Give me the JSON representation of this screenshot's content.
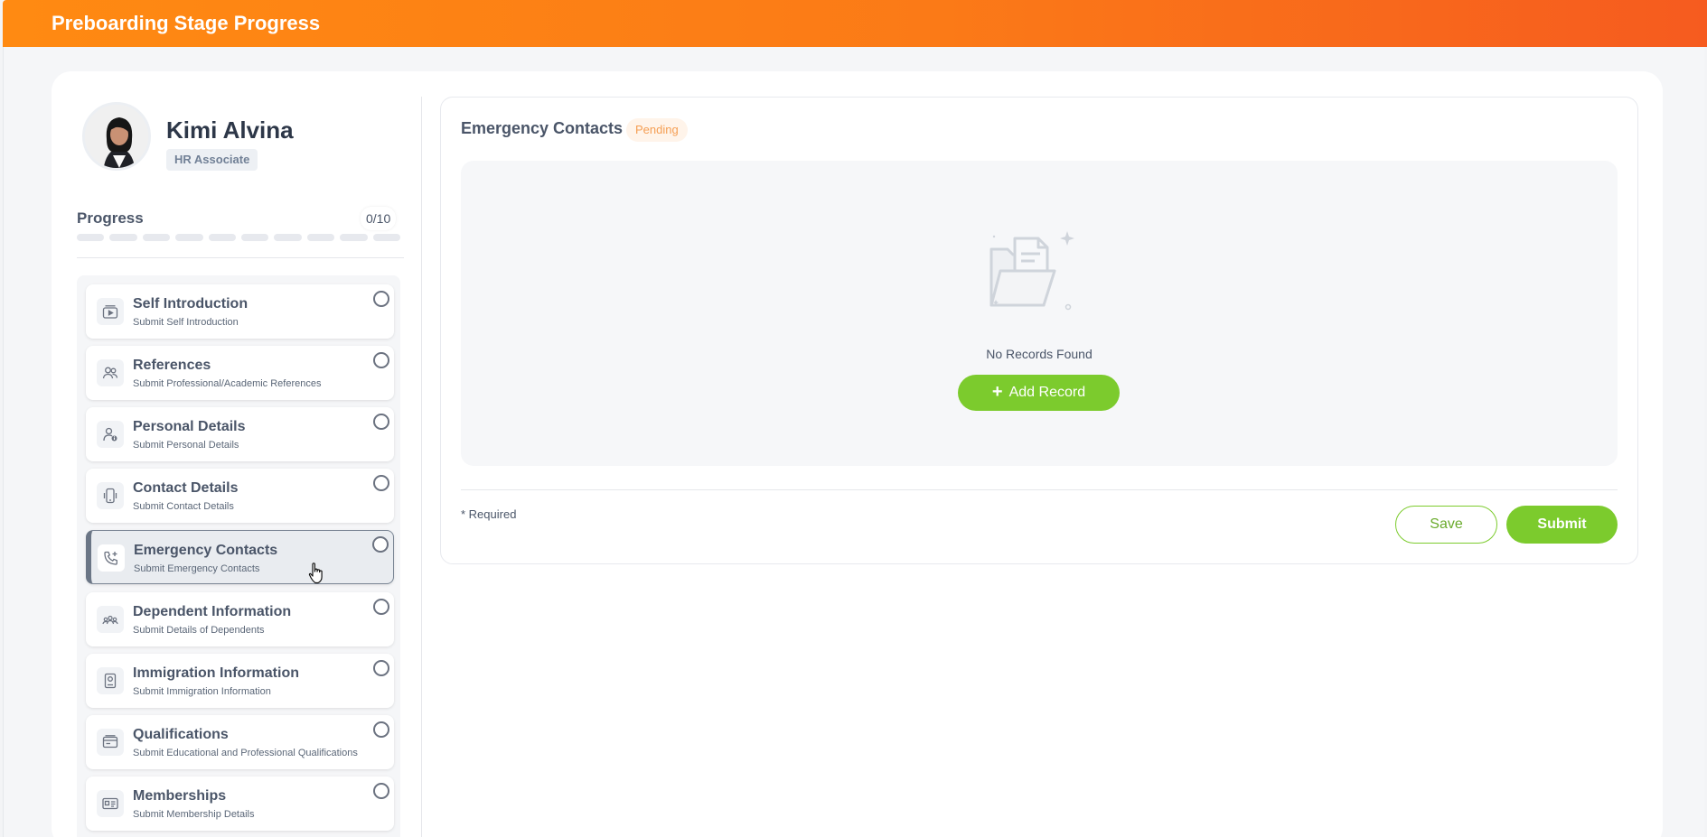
{
  "header": {
    "title": "Preboarding Stage Progress"
  },
  "profile": {
    "name": "Kimi Alvina",
    "role": "HR Associate"
  },
  "progress": {
    "label": "Progress",
    "count": "0/10",
    "completed": 0,
    "total": 10
  },
  "steps": [
    {
      "title": "Self Introduction",
      "subtitle": "Submit Self Introduction",
      "icon": "video-icon"
    },
    {
      "title": "References",
      "subtitle": "Submit Professional/Academic References",
      "icon": "people-icon"
    },
    {
      "title": "Personal Details",
      "subtitle": "Submit Personal Details",
      "icon": "user-info-icon"
    },
    {
      "title": "Contact Details",
      "subtitle": "Submit Contact Details",
      "icon": "phone-device-icon"
    },
    {
      "title": "Emergency Contacts",
      "subtitle": "Submit Emergency Contacts",
      "icon": "phone-plus-icon",
      "active": true
    },
    {
      "title": "Dependent Information",
      "subtitle": "Submit Details of Dependents",
      "icon": "group-icon"
    },
    {
      "title": "Immigration Information",
      "subtitle": "Submit Immigration Information",
      "icon": "passport-icon"
    },
    {
      "title": "Qualifications",
      "subtitle": "Submit Educational and Professional Qualifications",
      "icon": "certificate-icon"
    },
    {
      "title": "Memberships",
      "subtitle": "Submit Membership Details",
      "icon": "membership-card-icon"
    }
  ],
  "main": {
    "title": "Emergency Contacts",
    "status": "Pending",
    "empty_text": "No Records Found",
    "add_record_label": "Add Record",
    "required_note": "* Required",
    "save_label": "Save",
    "submit_label": "Submit"
  },
  "colors": {
    "header_start": "#ff8a12",
    "header_end": "#f65b1f",
    "accent_green": "#7ccb2d",
    "pending_text": "#f59e53"
  }
}
